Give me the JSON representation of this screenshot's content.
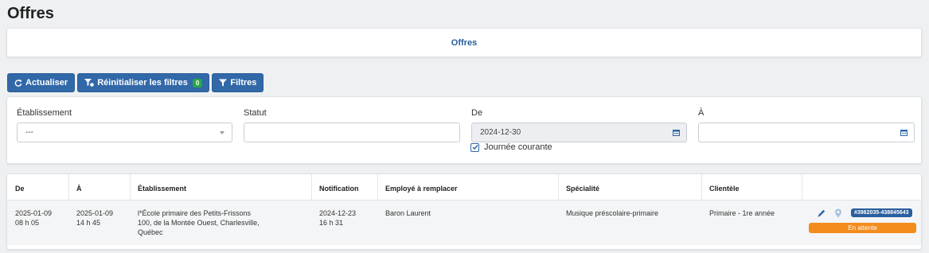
{
  "page": {
    "title": "Offres"
  },
  "tabs": {
    "offres_label": "Offres"
  },
  "toolbar": {
    "refresh_label": "Actualiser",
    "reset_filters_label": "Réinitialiser les filtres",
    "reset_filters_count": "0",
    "filters_label": "Filtres",
    "button_color": "#3168a8"
  },
  "filters": {
    "etablissement": {
      "label": "Établissement",
      "value": "---"
    },
    "statut": {
      "label": "Statut",
      "value": ""
    },
    "de": {
      "label": "De",
      "value": "2024-12-30"
    },
    "a": {
      "label": "À",
      "value": ""
    },
    "journee_courante": {
      "label": "Journée courante",
      "checked": true
    }
  },
  "table": {
    "headers": {
      "de": "De",
      "a": "À",
      "etablissement": "Établissement",
      "notification": "Notification",
      "employe": "Employé à remplacer",
      "specialite": "Spécialité",
      "clientele": "Clientèle"
    },
    "rows": [
      {
        "de_date": "2025-01-09",
        "de_time": "08 h 05",
        "a_date": "2025-01-09",
        "a_time": "14 h 45",
        "etab_line1": "l*École primaire des Petits-Frissons",
        "etab_line2": "100, de la Montée Ouest, Charlesville,",
        "etab_line3": "Québec",
        "notif_date": "2024-12-23",
        "notif_time": "16 h 31",
        "employe": "Baron Laurent",
        "specialite": "Musique préscolaire-primaire",
        "clientele": "Primaire - 1re année",
        "id_badge": "#3982035-438845643",
        "status": "En attente",
        "status_color": "#f28c1c"
      }
    ]
  },
  "icons": [
    "refresh-icon",
    "filter-reset-icon",
    "filter-icon",
    "calendar-icon",
    "checkmark-icon",
    "pencil-icon",
    "map-pin-icon"
  ]
}
